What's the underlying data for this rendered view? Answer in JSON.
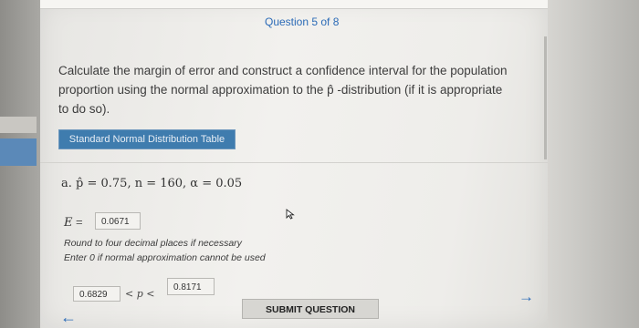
{
  "header": {
    "question_progress": "Question 5 of 8"
  },
  "question": {
    "line1": "Calculate the margin of error and construct a confidence interval for the population",
    "line2": "proportion using the normal approximation to the p̂ -distribution (if it is appropriate",
    "line3": "to do so)."
  },
  "table_button": "Standard Normal Distribution Table",
  "part_a": {
    "prompt": "a. p̂  = 0.75,  n = 160,  α  = 0.05",
    "e_label": "E",
    "e_equals": "=",
    "e_value": "0.0671",
    "note_round": "Round to four decimal places if necessary",
    "note_zero": "Enter 0 if normal approximation cannot be used",
    "ci_lower": "0.6829",
    "ci_middle": "< p <",
    "ci_upper": "0.8171"
  },
  "footer": {
    "submit_label": "SUBMIT QUESTION",
    "back_icon": "arrow-left-icon",
    "next_icon": "arrow-right-icon"
  },
  "colors": {
    "accent": "#2c6bb7",
    "table_button": "#3f7cae"
  }
}
